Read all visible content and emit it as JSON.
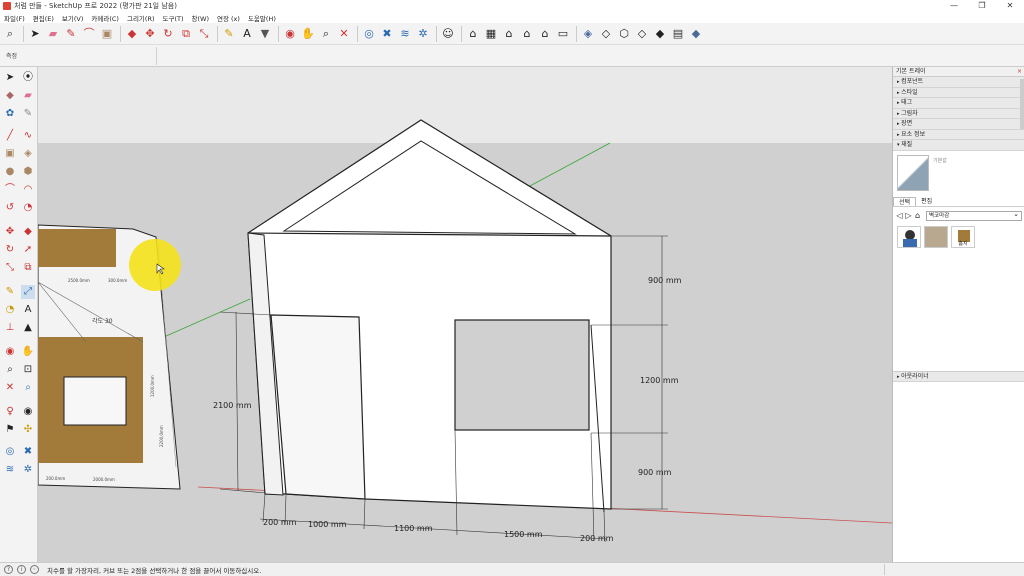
{
  "window": {
    "title": "처럼 만들 - SketchUp 프로 2022 (평가판 21일 남음)",
    "controls": [
      "—",
      "❐",
      "✕"
    ]
  },
  "menu": [
    "파일(F)",
    "편집(E)",
    "보기(V)",
    "카메라(C)",
    "그리기(R)",
    "도구(T)",
    "창(W)",
    "연장 (x)",
    "도움말(H)"
  ],
  "subbar": {
    "label": "측정"
  },
  "tray": {
    "title": "기본 트레이",
    "close": "×",
    "sections": [
      "컴포넌트",
      "스타일",
      "태그",
      "그림자",
      "장면",
      "요소 정보",
      "재질"
    ],
    "material": {
      "name": "기본값",
      "tabs": [
        "선택",
        "편집"
      ],
      "dropdown": "벽코마감",
      "thumb_label": "홈지"
    },
    "outliner": "아웃라이너"
  },
  "model": {
    "dimensions": {
      "top_height": "900 mm",
      "mid_height": "1200 mm",
      "bottom_height": "900 mm",
      "door_height": "2100 mm",
      "wall_left": "200 mm",
      "door_width": "1000 mm",
      "gap": "1100 mm",
      "window_width": "1500 mm",
      "wall_right": "200 mm"
    },
    "angle_label": "각도 30",
    "mini_labels": [
      "2500.0mm",
      "300.0mm",
      "1200.0mm",
      "2200.0mm",
      "200.0mm",
      "2000.0mm"
    ]
  },
  "status": {
    "text": "치수를 할 가장자리, 커브 또는 2점을 선택하거나 한 점을 끌어서 이동하십시오."
  },
  "colors": {
    "viewport_bg": "#e6e6e6",
    "ground": "#cfcfcf",
    "axis_red": "#c85050",
    "axis_green": "#3aa63a",
    "cursor_highlight": "#f4e11a",
    "brick": "#a27a3a"
  }
}
